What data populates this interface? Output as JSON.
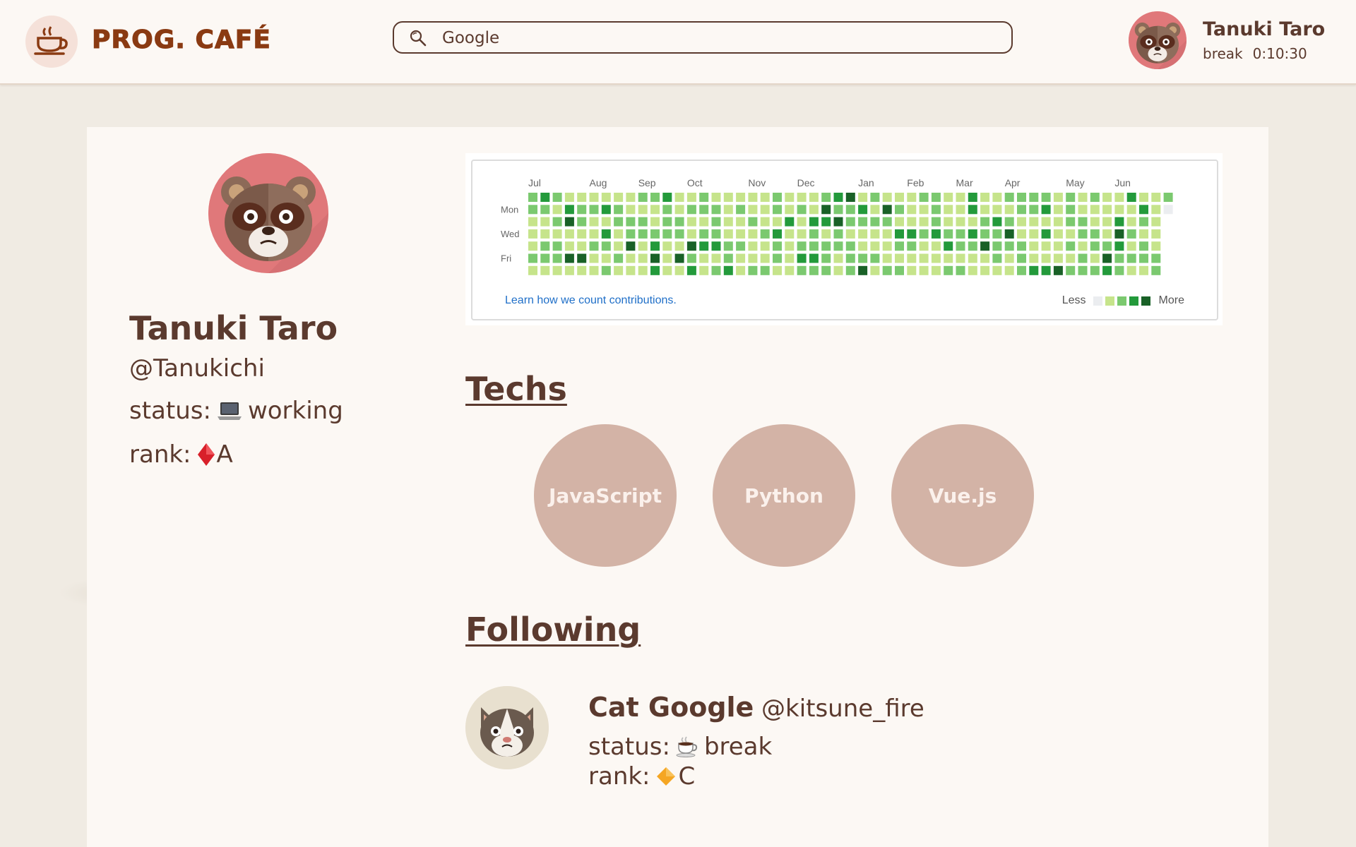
{
  "app": {
    "logo_text": "PROG. CAFÉ",
    "logo_icon": "coffee-cup-icon"
  },
  "search": {
    "value": "Google",
    "icon": "search-icon"
  },
  "current_user": {
    "name": "Tanuki Taro",
    "status_label": "break",
    "timer": "0:10:30",
    "avatar_icon": "tanuki-avatar-icon"
  },
  "profile": {
    "name": "Tanuki Taro",
    "handle": "@Tanukichi",
    "status_prefix": "status:",
    "status_icon": "laptop-icon",
    "status_text": "working",
    "rank_prefix": "rank:",
    "rank_icon": "red-diamond-icon",
    "rank_value": "A"
  },
  "contributions": {
    "months": [
      "Jul",
      "Aug",
      "Sep",
      "Oct",
      "Nov",
      "Dec",
      "Jan",
      "Feb",
      "Mar",
      "Apr",
      "May",
      "Jun"
    ],
    "days": [
      "Mon",
      "Wed",
      "Fri"
    ],
    "link_text": "Learn how we count contributions.",
    "legend_less": "Less",
    "legend_more": "More",
    "colors": [
      "#ebedf0",
      "#c6e48b",
      "#7bc96f",
      "#239a3b",
      "#196127"
    ]
  },
  "techs": {
    "title": "Techs",
    "items": [
      "JavaScript",
      "Python",
      "Vue.js"
    ]
  },
  "following": {
    "title": "Following",
    "items": [
      {
        "name": "Cat Google",
        "handle": "@kitsune_fire",
        "status_prefix": "status:",
        "status_icon": "coffee-icon",
        "status_text": "break",
        "rank_prefix": "rank:",
        "rank_icon": "orange-diamond-icon",
        "rank_value": "C"
      }
    ]
  }
}
